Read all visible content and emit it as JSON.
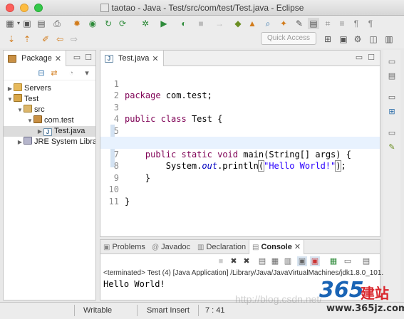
{
  "window": {
    "title": "taotao - Java - Test/src/com/test/Test.java - Eclipse"
  },
  "toolbar": {
    "quick_access_placeholder": "Quick Access"
  },
  "package_explorer": {
    "tab_label": "Package",
    "tree": [
      {
        "label": "Servers",
        "icon": "folder-icon",
        "expanded": false,
        "depth": 0
      },
      {
        "label": "Test",
        "icon": "project-icon",
        "expanded": true,
        "depth": 0
      },
      {
        "label": "src",
        "icon": "source-folder-icon",
        "expanded": true,
        "depth": 1
      },
      {
        "label": "com.test",
        "icon": "package-icon",
        "expanded": true,
        "depth": 2
      },
      {
        "label": "Test.java",
        "icon": "java-file-icon",
        "expanded": false,
        "depth": 3,
        "selected": true
      },
      {
        "label": "JRE System Librar",
        "icon": "library-icon",
        "expanded": false,
        "depth": 1
      }
    ]
  },
  "editor": {
    "tab_label": "Test.java",
    "current_line": 7,
    "lines": [
      {
        "num": "1",
        "code": "package com.test;"
      },
      {
        "num": "2",
        "code": ""
      },
      {
        "num": "3",
        "code": "public class Test {"
      },
      {
        "num": "4",
        "code": ""
      },
      {
        "num": "5",
        "code": "    public static void main(String[] args) {"
      },
      {
        "num": "6",
        "code": ""
      },
      {
        "num": "7",
        "code": "        System.out.println(\"Hello World!\");"
      },
      {
        "num": "8",
        "code": "    }"
      },
      {
        "num": "9",
        "code": ""
      },
      {
        "num": "10",
        "code": "}"
      },
      {
        "num": "11",
        "code": ""
      }
    ]
  },
  "console": {
    "tabs": [
      {
        "label": "Problems",
        "icon": "problems-icon"
      },
      {
        "label": "Javadoc",
        "icon": "at-icon"
      },
      {
        "label": "Declaration",
        "icon": "declaration-icon"
      },
      {
        "label": "Console",
        "icon": "console-icon",
        "active": true
      }
    ],
    "status": "<terminated> Test (4) [Java Application] /Library/Java/JavaVirtualMachines/jdk1.8.0_101.",
    "output": "Hello World!"
  },
  "statusbar": {
    "writable": "Writable",
    "insert_mode": "Smart Insert",
    "position": "7 : 41"
  },
  "watermark": {
    "text": "http://blog.csdn.net/",
    "logo_main": "365",
    "logo_sub": "建站",
    "logo_url": "www.365jz.com"
  },
  "colors": {
    "keyword": "#7f0055",
    "string": "#2a00ff",
    "static_field": "#0000c0",
    "current_line": "#e8f2fe",
    "selection": "#dcdcdc"
  }
}
